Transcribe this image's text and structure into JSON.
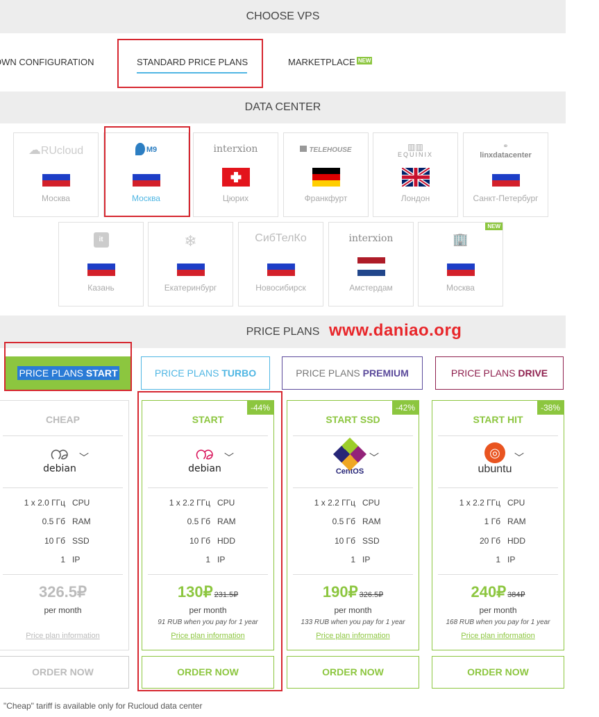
{
  "sections": {
    "choose_vps": "CHOOSE VPS",
    "data_center": "DATA CENTER",
    "price_plans": "PRICE PLANS"
  },
  "watermark": "www.daniao.org",
  "tabs": {
    "own": "OWN CONFIGURATION",
    "standard": "STANDARD PRICE PLANS",
    "marketplace": "MARKETPLACE",
    "marketplace_badge": "NEW"
  },
  "datacenters": [
    {
      "logo": "RUcloud",
      "city": "Москва",
      "flag": "ru"
    },
    {
      "logo": "M9",
      "city": "Москва",
      "flag": "ru",
      "active": true
    },
    {
      "logo": "interxion",
      "city": "Цюрих",
      "flag": "ch"
    },
    {
      "logo": "TELEHOUSE",
      "city": "Франкфурт",
      "flag": "de"
    },
    {
      "logo": "EQUINIX",
      "city": "Лондон",
      "flag": "gb"
    },
    {
      "logo": "linxdatacenter",
      "city": "Санкт-Петербург",
      "flag": "ru"
    },
    {
      "logo": "it park",
      "city": "Казань",
      "flag": "ru"
    },
    {
      "logo": "",
      "city": "Екатеринбург",
      "flag": "ru"
    },
    {
      "logo": "СибТелКо",
      "city": "Новосибирск",
      "flag": "ru"
    },
    {
      "logo": "interxion",
      "city": "Амстердам",
      "flag": "nl"
    },
    {
      "logo": "",
      "city": "Москва",
      "flag": "ru",
      "badge": "NEW"
    }
  ],
  "plan_tabs": [
    {
      "prefix": "PRICE PLANS",
      "name": "START",
      "color": "#8cc63f"
    },
    {
      "prefix": "PRICE PLANS",
      "name": "TURBO",
      "color": "#4fb6e3"
    },
    {
      "prefix": "PRICE PLANS",
      "name": "PREMIUM",
      "color": "#5b4a9b"
    },
    {
      "prefix": "PRICE PLANS",
      "name": "DRIVE",
      "color": "#8e1f4d"
    }
  ],
  "plans": [
    {
      "name": "CHEAP",
      "os": "debian",
      "discount": "",
      "cpu": "1 x 2.0 ГГц",
      "ram": "0.5 Гб",
      "disk": "10 Гб",
      "disk_type": "SSD",
      "ip": "1",
      "price": "326.5₽",
      "old_price": "",
      "per_month": "per month",
      "yearly": "",
      "info": "Price plan information",
      "order": "ORDER NOW",
      "disabled": true
    },
    {
      "name": "START",
      "os": "debian",
      "discount": "-44%",
      "cpu": "1 x 2.2 ГГц",
      "ram": "0.5 Гб",
      "disk": "10 Гб",
      "disk_type": "HDD",
      "ip": "1",
      "price": "130₽",
      "old_price": "231.5₽",
      "per_month": "per month",
      "yearly": "91 RUB when you pay for 1 year",
      "info": "Price plan information",
      "order": "ORDER NOW"
    },
    {
      "name": "START SSD",
      "os": "CentOS",
      "discount": "-42%",
      "cpu": "1 x 2.2 ГГц",
      "ram": "0.5 Гб",
      "disk": "10 Гб",
      "disk_type": "SSD",
      "ip": "1",
      "price": "190₽",
      "old_price": "326.5₽",
      "per_month": "per month",
      "yearly": "133 RUB when you pay for 1 year",
      "info": "Price plan information",
      "order": "ORDER NOW"
    },
    {
      "name": "START HIT",
      "os": "ubuntu",
      "discount": "-38%",
      "cpu": "1 x 2.2 ГГц",
      "ram": "1 Гб",
      "disk": "20 Гб",
      "disk_type": "HDD",
      "ip": "1",
      "price": "240₽",
      "old_price": "384₽",
      "per_month": "per month",
      "yearly": "168 RUB when you pay for 1 year",
      "info": "Price plan information",
      "order": "ORDER NOW"
    }
  ],
  "spec_units": {
    "cpu": "CPU",
    "ram": "RAM",
    "ip": "IP"
  },
  "footnote": "\"Cheap\" tariff is available only for Rucloud data center",
  "colors": {
    "accent_green": "#8cc63f",
    "accent_blue": "#4fb6e3",
    "highlight_red": "#d6262f"
  }
}
